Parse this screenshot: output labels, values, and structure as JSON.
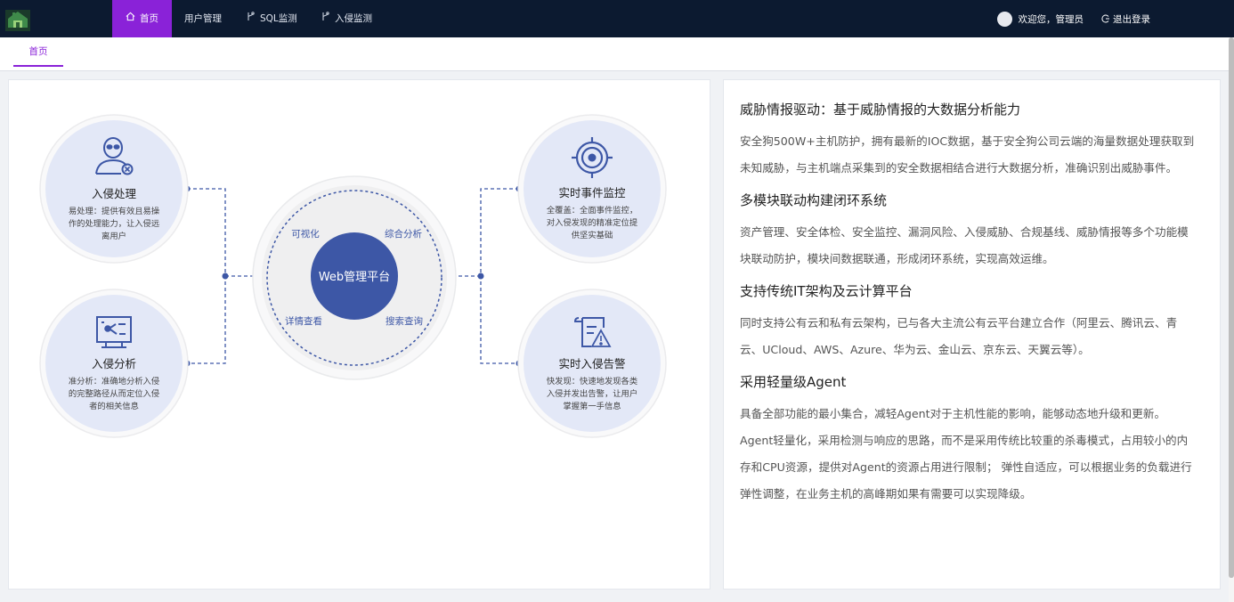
{
  "nav": {
    "items": [
      {
        "label": "首页",
        "icon": "home-icon",
        "active": true
      },
      {
        "label": "用户管理",
        "icon": "",
        "active": false
      },
      {
        "label": "SQL监测",
        "icon": "branch-icon",
        "active": false
      },
      {
        "label": "入侵监测",
        "icon": "branch-icon",
        "active": false
      }
    ],
    "welcome": "欢迎您，管理员",
    "logout": "退出登录",
    "accent": "#8a22d8",
    "bg": "#0c1a30"
  },
  "tabs": {
    "active": "首页"
  },
  "diagram": {
    "center": "Web管理平台",
    "ring_labels": [
      "可视化",
      "综合分析",
      "详情查看",
      "搜索查询"
    ],
    "nodes": {
      "intrusion_handle": {
        "title": "入侵处理",
        "desc": [
          "易处理：提供有效且易操",
          "作的处理能力，让入侵远",
          "离用户"
        ],
        "icon": "alien-icon"
      },
      "intrusion_analysis": {
        "title": "入侵分析",
        "desc": [
          "准分析：准确地分析入侵",
          "的完整路径从而定位入侵",
          "者的相关信息"
        ],
        "icon": "monitor-analysis-icon"
      },
      "realtime_monitor": {
        "title": "实时事件监控",
        "desc": [
          "全覆盖：全面事件监控，",
          "对入侵发现的精准定位提",
          "供坚实基础"
        ],
        "icon": "target-icon"
      },
      "realtime_alert": {
        "title": "实时入侵告警",
        "desc": [
          "快发现：快速地发现各类",
          "入侵并发出告警，让用户",
          "掌握第一手信息"
        ],
        "icon": "alert-document-icon"
      }
    },
    "colors": {
      "primary": "#3d57a6",
      "node_bg": "#e3e8f7",
      "ring_bg": "#efeff0"
    }
  },
  "features": [
    {
      "title": "威胁情报驱动：基于威胁情报的大数据分析能力",
      "desc": [
        "安全狗500W+主机防护，拥有最新的IOC数据，基于安全狗公司云端的海量数据处理获取到",
        "未知威胁，与主机端点采集到的安全数据相结合进行大数据分析，准确识别出威胁事件。"
      ]
    },
    {
      "title": "多模块联动构建闭环系统",
      "desc": [
        "资产管理、安全体检、安全监控、漏洞风险、入侵威胁、合规基线、威胁情报等多个功能模",
        "块联动防护，模块间数据联通，形成闭环系统，实现高效运维。"
      ]
    },
    {
      "title": "支持传统IT架构及云计算平台",
      "desc": [
        "同时支持公有云和私有云架构，已与各大主流公有云平台建立合作（阿里云、腾讯云、青",
        "云、UCloud、AWS、Azure、华为云、金山云、京东云、天翼云等）。"
      ]
    },
    {
      "title": "采用轻量级Agent",
      "desc": [
        "具备全部功能的最小集合，减轻Agent对于主机性能的影响，能够动态地升级和更新。",
        "Agent轻量化，采用检测与响应的思路，而不是采用传统比较重的杀毒模式，占用较小的内",
        "存和CPU资源，提供对Agent的资源占用进行限制；  弹性自适应，可以根据业务的负载进行",
        "弹性调整，在业务主机的高峰期如果有需要可以实现降级。"
      ]
    }
  ]
}
